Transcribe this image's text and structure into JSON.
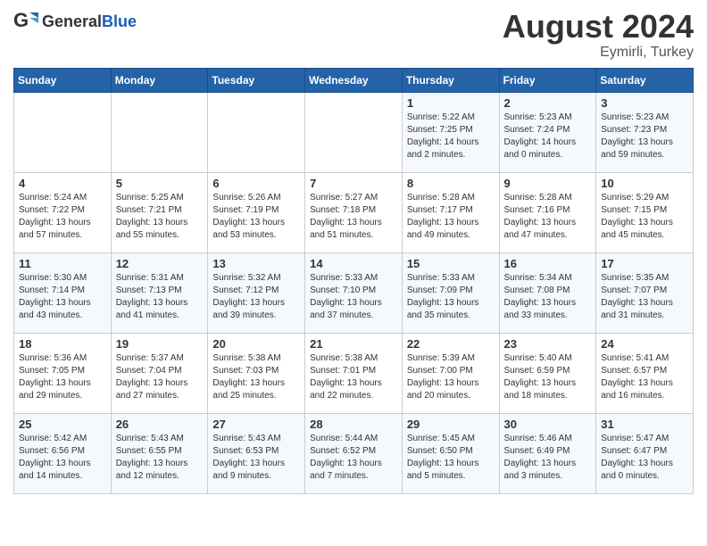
{
  "header": {
    "logo_general": "General",
    "logo_blue": "Blue",
    "month_year": "August 2024",
    "location": "Eymirli, Turkey"
  },
  "days_of_week": [
    "Sunday",
    "Monday",
    "Tuesday",
    "Wednesday",
    "Thursday",
    "Friday",
    "Saturday"
  ],
  "weeks": [
    [
      {
        "day": "",
        "info": ""
      },
      {
        "day": "",
        "info": ""
      },
      {
        "day": "",
        "info": ""
      },
      {
        "day": "",
        "info": ""
      },
      {
        "day": "1",
        "info": "Sunrise: 5:22 AM\nSunset: 7:25 PM\nDaylight: 14 hours\nand 2 minutes."
      },
      {
        "day": "2",
        "info": "Sunrise: 5:23 AM\nSunset: 7:24 PM\nDaylight: 14 hours\nand 0 minutes."
      },
      {
        "day": "3",
        "info": "Sunrise: 5:23 AM\nSunset: 7:23 PM\nDaylight: 13 hours\nand 59 minutes."
      }
    ],
    [
      {
        "day": "4",
        "info": "Sunrise: 5:24 AM\nSunset: 7:22 PM\nDaylight: 13 hours\nand 57 minutes."
      },
      {
        "day": "5",
        "info": "Sunrise: 5:25 AM\nSunset: 7:21 PM\nDaylight: 13 hours\nand 55 minutes."
      },
      {
        "day": "6",
        "info": "Sunrise: 5:26 AM\nSunset: 7:19 PM\nDaylight: 13 hours\nand 53 minutes."
      },
      {
        "day": "7",
        "info": "Sunrise: 5:27 AM\nSunset: 7:18 PM\nDaylight: 13 hours\nand 51 minutes."
      },
      {
        "day": "8",
        "info": "Sunrise: 5:28 AM\nSunset: 7:17 PM\nDaylight: 13 hours\nand 49 minutes."
      },
      {
        "day": "9",
        "info": "Sunrise: 5:28 AM\nSunset: 7:16 PM\nDaylight: 13 hours\nand 47 minutes."
      },
      {
        "day": "10",
        "info": "Sunrise: 5:29 AM\nSunset: 7:15 PM\nDaylight: 13 hours\nand 45 minutes."
      }
    ],
    [
      {
        "day": "11",
        "info": "Sunrise: 5:30 AM\nSunset: 7:14 PM\nDaylight: 13 hours\nand 43 minutes."
      },
      {
        "day": "12",
        "info": "Sunrise: 5:31 AM\nSunset: 7:13 PM\nDaylight: 13 hours\nand 41 minutes."
      },
      {
        "day": "13",
        "info": "Sunrise: 5:32 AM\nSunset: 7:12 PM\nDaylight: 13 hours\nand 39 minutes."
      },
      {
        "day": "14",
        "info": "Sunrise: 5:33 AM\nSunset: 7:10 PM\nDaylight: 13 hours\nand 37 minutes."
      },
      {
        "day": "15",
        "info": "Sunrise: 5:33 AM\nSunset: 7:09 PM\nDaylight: 13 hours\nand 35 minutes."
      },
      {
        "day": "16",
        "info": "Sunrise: 5:34 AM\nSunset: 7:08 PM\nDaylight: 13 hours\nand 33 minutes."
      },
      {
        "day": "17",
        "info": "Sunrise: 5:35 AM\nSunset: 7:07 PM\nDaylight: 13 hours\nand 31 minutes."
      }
    ],
    [
      {
        "day": "18",
        "info": "Sunrise: 5:36 AM\nSunset: 7:05 PM\nDaylight: 13 hours\nand 29 minutes."
      },
      {
        "day": "19",
        "info": "Sunrise: 5:37 AM\nSunset: 7:04 PM\nDaylight: 13 hours\nand 27 minutes."
      },
      {
        "day": "20",
        "info": "Sunrise: 5:38 AM\nSunset: 7:03 PM\nDaylight: 13 hours\nand 25 minutes."
      },
      {
        "day": "21",
        "info": "Sunrise: 5:38 AM\nSunset: 7:01 PM\nDaylight: 13 hours\nand 22 minutes."
      },
      {
        "day": "22",
        "info": "Sunrise: 5:39 AM\nSunset: 7:00 PM\nDaylight: 13 hours\nand 20 minutes."
      },
      {
        "day": "23",
        "info": "Sunrise: 5:40 AM\nSunset: 6:59 PM\nDaylight: 13 hours\nand 18 minutes."
      },
      {
        "day": "24",
        "info": "Sunrise: 5:41 AM\nSunset: 6:57 PM\nDaylight: 13 hours\nand 16 minutes."
      }
    ],
    [
      {
        "day": "25",
        "info": "Sunrise: 5:42 AM\nSunset: 6:56 PM\nDaylight: 13 hours\nand 14 minutes."
      },
      {
        "day": "26",
        "info": "Sunrise: 5:43 AM\nSunset: 6:55 PM\nDaylight: 13 hours\nand 12 minutes."
      },
      {
        "day": "27",
        "info": "Sunrise: 5:43 AM\nSunset: 6:53 PM\nDaylight: 13 hours\nand 9 minutes."
      },
      {
        "day": "28",
        "info": "Sunrise: 5:44 AM\nSunset: 6:52 PM\nDaylight: 13 hours\nand 7 minutes."
      },
      {
        "day": "29",
        "info": "Sunrise: 5:45 AM\nSunset: 6:50 PM\nDaylight: 13 hours\nand 5 minutes."
      },
      {
        "day": "30",
        "info": "Sunrise: 5:46 AM\nSunset: 6:49 PM\nDaylight: 13 hours\nand 3 minutes."
      },
      {
        "day": "31",
        "info": "Sunrise: 5:47 AM\nSunset: 6:47 PM\nDaylight: 13 hours\nand 0 minutes."
      }
    ]
  ]
}
